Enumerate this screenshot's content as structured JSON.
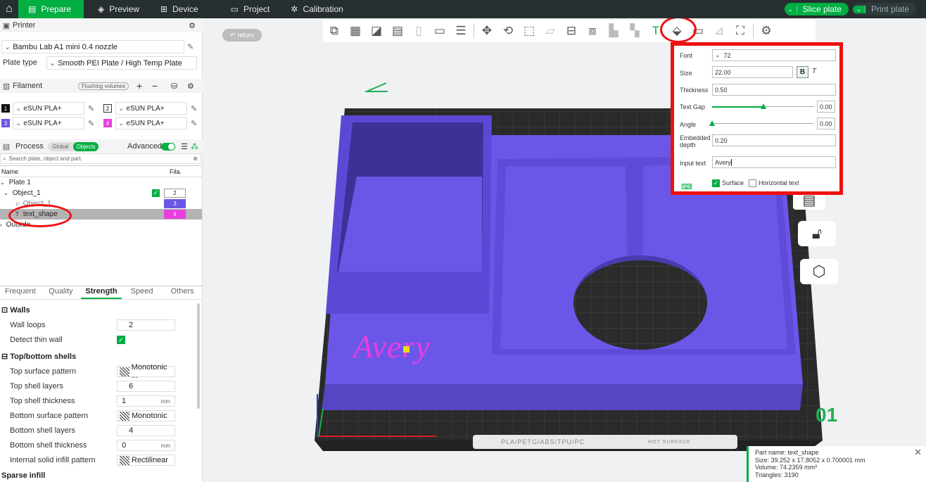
{
  "topbar": {
    "tabs": [
      {
        "label": "Prepare",
        "icon": "prepare-icon",
        "active": true
      },
      {
        "label": "Preview",
        "icon": "cube-icon"
      },
      {
        "label": "Device",
        "icon": "device-icon"
      },
      {
        "label": "Project",
        "icon": "project-icon"
      },
      {
        "label": "Calibration",
        "icon": "calibration-icon"
      }
    ],
    "slice_label": "Slice plate",
    "print_label": "Print plate",
    "accent": "#00ae42"
  },
  "printer": {
    "header": "Printer",
    "name": "Bambu Lab A1 mini 0.4 nozzle",
    "plate_type_label": "Plate type",
    "plate_type": "Smooth PEI Plate / High Temp Plate"
  },
  "filament": {
    "header": "Filament",
    "flushing_label": "Flushing volumes",
    "items": [
      {
        "num": "1",
        "name": "eSUN PLA+",
        "color": "#111111"
      },
      {
        "num": "2",
        "name": "eSUN PLA+",
        "color": "#ffffff"
      },
      {
        "num": "3",
        "name": "eSUN PLA+",
        "color": "#6a57e8"
      },
      {
        "num": "4",
        "name": "eSUN PLA+",
        "color": "#e83ee0"
      }
    ]
  },
  "process": {
    "header": "Process",
    "global_label": "Global",
    "objects_label": "Objects",
    "advanced_label": "Advanced",
    "search_placeholder": "Search plate, object and part."
  },
  "tree": {
    "col_name": "Name",
    "col_fila": "Fila.",
    "rows": [
      {
        "label": "Plate 1",
        "fila": ""
      },
      {
        "label": "Object_1",
        "fila": "2"
      },
      {
        "label": "Object_1",
        "fila": "3"
      },
      {
        "label": "text_shape",
        "fila": "4"
      },
      {
        "label": "Outside",
        "fila": ""
      }
    ]
  },
  "settings_tabs": [
    "Frequent",
    "Quality",
    "Strength",
    "Speed",
    "Others"
  ],
  "strength": {
    "walls_header": "Walls",
    "wall_loops_label": "Wall loops",
    "wall_loops": "2",
    "detect_thin_wall_label": "Detect thin wall",
    "topbottom_header": "Top/bottom shells",
    "top_surface_pattern_label": "Top surface pattern",
    "top_surface_pattern": "Monotonic ...",
    "top_shell_layers_label": "Top shell layers",
    "top_shell_layers": "6",
    "top_shell_thickness_label": "Top shell thickness",
    "top_shell_thickness": "1",
    "mm": "mm",
    "bottom_surface_pattern_label": "Bottom surface pattern",
    "bottom_surface_pattern": "Monotonic",
    "bottom_shell_layers_label": "Bottom shell layers",
    "bottom_shell_layers": "4",
    "bottom_shell_thickness_label": "Bottom shell thickness",
    "bottom_shell_thickness": "0",
    "internal_solid_infill_label": "Internal solid infill pattern",
    "internal_solid_infill": "Rectilinear",
    "sparse_infill_header": "Sparse infill"
  },
  "viewport": {
    "return_label": "return",
    "plate_number": "01",
    "plate_text": "PLA/PETG/ABS/TPU/PC",
    "plate_text2": "HOT SURFACE",
    "model_text": "Avery",
    "model_color": "#6a57e8"
  },
  "text_panel": {
    "font_label": "Font",
    "font_value": "72",
    "size_label": "Size",
    "size_value": "22.00",
    "bold_label": "B",
    "italic_label": "T",
    "thickness_label": "Thickness",
    "thickness_value": "0.50",
    "text_gap_label": "Text Gap",
    "text_gap_value": "0.00",
    "text_gap_level": 0.5,
    "angle_label": "Angle",
    "angle_value": "0.00",
    "angle_level": 0.0,
    "embedded_label": "Embedded depth",
    "embedded_value": "0.20",
    "input_label": "Input text",
    "input_value": "Avery",
    "surface_label": "Surface",
    "horizontal_label": "Horizontal text"
  },
  "info": {
    "line1": "Part name: text_shape",
    "line2": "Size: 39.252 x 17.8052 x 0.700001 mm",
    "line3": "Volume: 74.2359 mm³",
    "line4": "Triangles: 3190"
  }
}
